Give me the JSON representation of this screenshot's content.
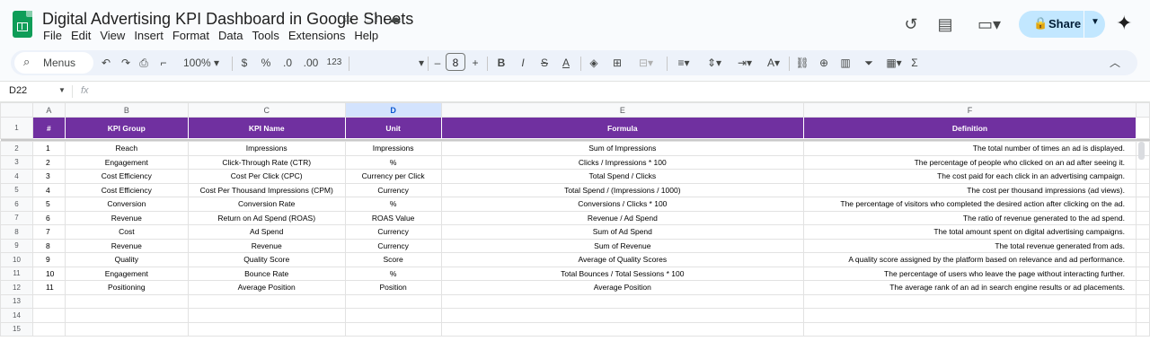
{
  "app": {
    "title": "Digital Advertising KPI Dashboard in Google Sheets",
    "menu": [
      "File",
      "Edit",
      "View",
      "Insert",
      "Format",
      "Data",
      "Tools",
      "Extensions",
      "Help"
    ],
    "share_label": "Share"
  },
  "toolbar": {
    "menus_label": "Menus",
    "zoom": "100%",
    "currency": "$",
    "percent": "%",
    "dec_decrease": ".0",
    "dec_increase": ".00",
    "format_123": "123",
    "font_size": "8",
    "minus": "–",
    "plus": "+",
    "bold": "B",
    "italic": "I",
    "strike": "S",
    "text_color": "A",
    "sigma": "Σ"
  },
  "formula_bar": {
    "cell_ref": "D22",
    "fx": "fx",
    "value": ""
  },
  "grid": {
    "columns": [
      "A",
      "B",
      "C",
      "D",
      "E",
      "F"
    ],
    "selected_column": "D",
    "header": [
      "#",
      "KPI Group",
      "KPI Name",
      "Unit",
      "Formula",
      "Definition"
    ],
    "rows": [
      [
        "1",
        "Reach",
        "Impressions",
        "Impressions",
        "Sum of Impressions",
        "The total number of times an ad is displayed."
      ],
      [
        "2",
        "Engagement",
        "Click-Through Rate (CTR)",
        "%",
        "Clicks / Impressions * 100",
        "The percentage of people who clicked on an ad after seeing it."
      ],
      [
        "3",
        "Cost Efficiency",
        "Cost Per Click (CPC)",
        "Currency per Click",
        "Total Spend / Clicks",
        "The cost paid for each click in an advertising campaign."
      ],
      [
        "4",
        "Cost Efficiency",
        "Cost Per Thousand Impressions (CPM)",
        "Currency",
        "Total Spend / (Impressions / 1000)",
        "The cost per thousand impressions (ad views)."
      ],
      [
        "5",
        "Conversion",
        "Conversion Rate",
        "%",
        "Conversions / Clicks * 100",
        "The percentage of visitors who completed the desired action after clicking on the ad."
      ],
      [
        "6",
        "Revenue",
        "Return on Ad Spend (ROAS)",
        "ROAS Value",
        "Revenue / Ad Spend",
        "The ratio of revenue generated to the ad spend."
      ],
      [
        "7",
        "Cost",
        "Ad Spend",
        "Currency",
        "Sum of Ad Spend",
        "The total amount spent on digital advertising campaigns."
      ],
      [
        "8",
        "Revenue",
        "Revenue",
        "Currency",
        "Sum of Revenue",
        "The total revenue generated from ads."
      ],
      [
        "9",
        "Quality",
        "Quality Score",
        "Score",
        "Average of Quality Scores",
        "A quality score assigned by the platform based on relevance and ad performance."
      ],
      [
        "10",
        "Engagement",
        "Bounce Rate",
        "%",
        "Total Bounces / Total Sessions * 100",
        "The percentage of users who leave the page without interacting further."
      ],
      [
        "11",
        "Positioning",
        "Average Position",
        "Position",
        "Average Position",
        "The average rank of an ad in search engine results or ad placements."
      ]
    ],
    "row_numbers": [
      "1",
      "2",
      "3",
      "4",
      "5",
      "6",
      "7",
      "8",
      "9",
      "10",
      "11",
      "12",
      "13",
      "14",
      "15"
    ]
  },
  "colors": {
    "header_bg": "#7030a0",
    "header_text": "#ffffff",
    "share_bg": "#c2e7ff",
    "selected_col": "#d3e3fd"
  }
}
